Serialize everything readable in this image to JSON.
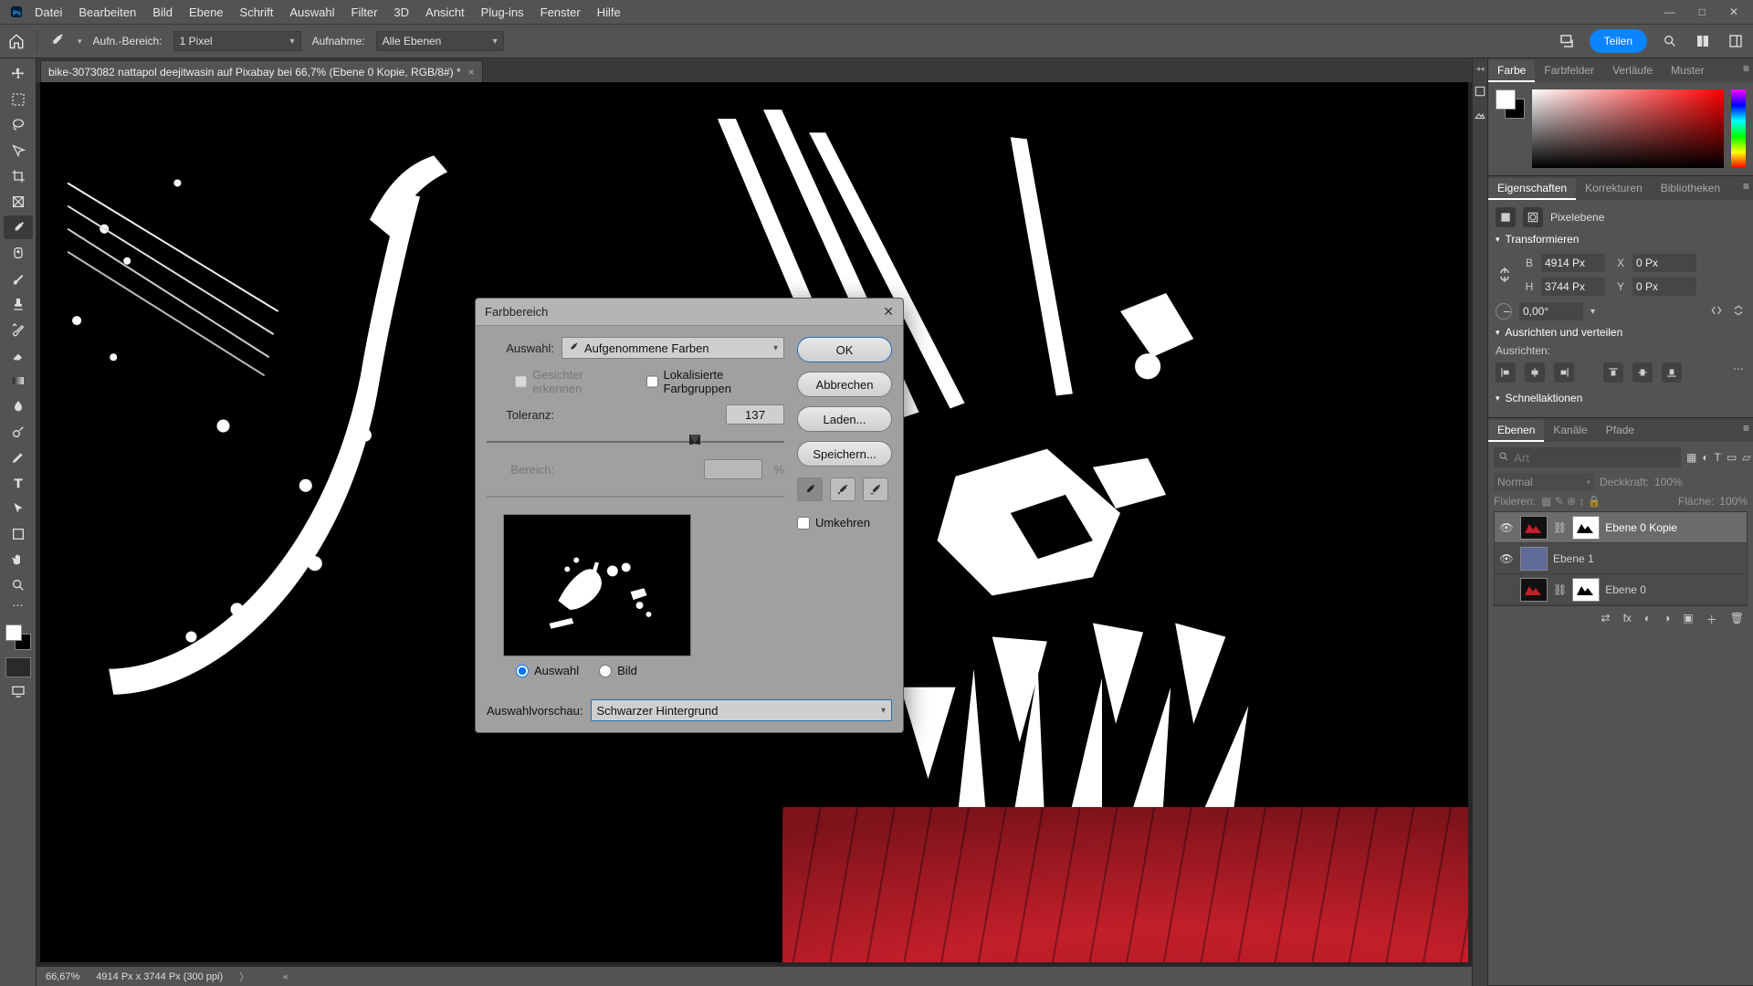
{
  "menubar": {
    "items": [
      "Datei",
      "Bearbeiten",
      "Bild",
      "Ebene",
      "Schrift",
      "Auswahl",
      "Filter",
      "3D",
      "Ansicht",
      "Plug-ins",
      "Fenster",
      "Hilfe"
    ]
  },
  "optionsbar": {
    "sample_label": "Aufn.-Bereich:",
    "sample_value": "1 Pixel",
    "sample2_label": "Aufnahme:",
    "sample2_value": "Alle Ebenen",
    "share": "Teilen"
  },
  "document": {
    "tab_title": "bike-3073082 nattapol deejitwasin auf Pixabay bei 66,7% (Ebene 0 Kopie, RGB/8#) *"
  },
  "status": {
    "zoom": "66,67%",
    "dims": "4914 Px x 3744 Px (300 ppi)"
  },
  "dialog": {
    "title": "Farbbereich",
    "auswahl_label": "Auswahl:",
    "auswahl_value": "Aufgenommene Farben",
    "faces_label": "Gesichter erkennen",
    "localized_label": "Lokalisierte Farbgruppen",
    "toleranz_label": "Toleranz:",
    "toleranz_value": "137",
    "toleranz_percent": 68,
    "bereich_label": "Bereich:",
    "bereich_value": "",
    "radio_auswahl": "Auswahl",
    "radio_bild": "Bild",
    "vorschau_label": "Auswahlvorschau:",
    "vorschau_value": "Schwarzer Hintergrund",
    "ok": "OK",
    "cancel": "Abbrechen",
    "load": "Laden...",
    "save": "Speichern...",
    "invert": "Umkehren",
    "pct": "%"
  },
  "panels": {
    "color_tabs": [
      "Farbe",
      "Farbfelder",
      "Verläufe",
      "Muster"
    ],
    "props_tabs": [
      "Eigenschaften",
      "Korrekturen",
      "Bibliotheken"
    ],
    "props": {
      "type_label": "Pixelebene",
      "transform": "Transformieren",
      "w_label": "B",
      "w_value": "4914 Px",
      "h_label": "H",
      "h_value": "3744 Px",
      "x_label": "X",
      "x_value": "0 Px",
      "y_label": "Y",
      "y_value": "0 Px",
      "angle_value": "0,00°",
      "align_title": "Ausrichten und verteilen",
      "align_label": "Ausrichten:",
      "quick_title": "Schnellaktionen"
    },
    "layers_tabs": [
      "Ebenen",
      "Kanäle",
      "Pfade"
    ],
    "layers": {
      "search_placeholder": "Art",
      "blend_mode": "Normal",
      "opacity_label": "Deckkraft:",
      "opacity_value": "100%",
      "fix_label": "Fixieren:",
      "fill_label": "Fläche:",
      "fill_value": "100%",
      "rows": [
        {
          "name": "Ebene 0 Kopie",
          "visible": true,
          "mask": true,
          "sel": true
        },
        {
          "name": "Ebene 1",
          "visible": true,
          "mask": false,
          "sel": false,
          "solid": "#5f6a9a"
        },
        {
          "name": "Ebene 0",
          "visible": false,
          "mask": true,
          "sel": false
        }
      ]
    }
  }
}
